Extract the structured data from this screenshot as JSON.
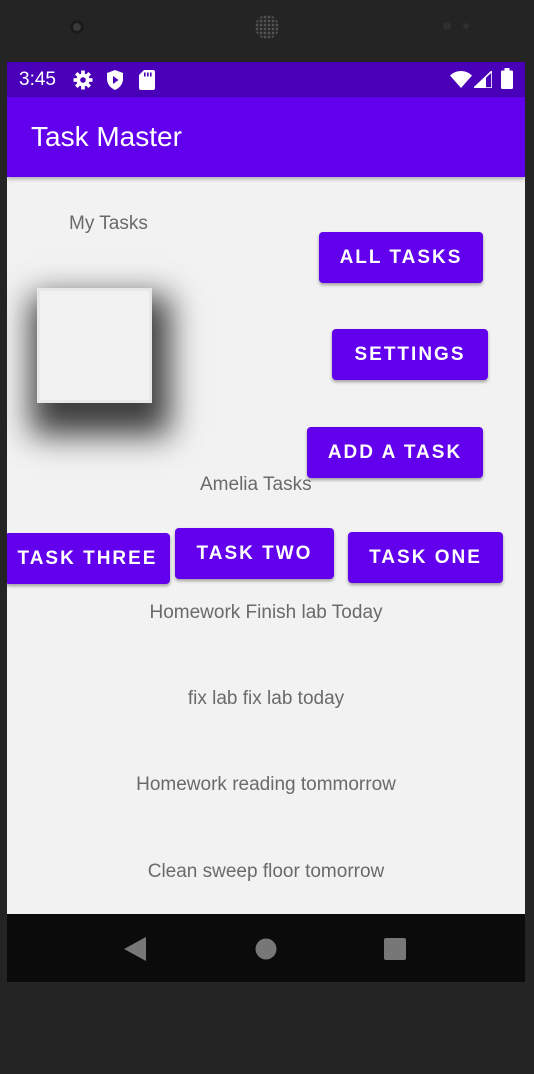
{
  "status_bar": {
    "time": "3:45",
    "left_icons": [
      "gear-icon",
      "shield-icon",
      "sd-card-icon"
    ],
    "right_icons": [
      "wifi-icon",
      "signal-icon",
      "battery-icon"
    ]
  },
  "app_bar": {
    "title": "Task Master"
  },
  "main": {
    "heading": "My Tasks",
    "buttons": {
      "all_tasks": "ALL TASKS",
      "settings": "SETTINGS",
      "add_task": "ADD A TASK"
    },
    "user_tasks_label": "Amelia Tasks",
    "task_buttons": {
      "task_three": "TASK THREE",
      "task_two": "TASK TWO",
      "task_one": "TASK ONE"
    },
    "task_list": [
      "Homework Finish lab Today",
      "fix lab fix lab today",
      "Homework reading tommorrow",
      "Clean sweep floor tomorrow"
    ]
  },
  "nav_bar": {
    "icons": [
      "back-icon",
      "home-icon",
      "recents-icon"
    ]
  },
  "colors": {
    "status_bar": "#4a00b8",
    "primary": "#6200ee",
    "background": "#f2f2f2",
    "text": "#6a6a6a"
  }
}
